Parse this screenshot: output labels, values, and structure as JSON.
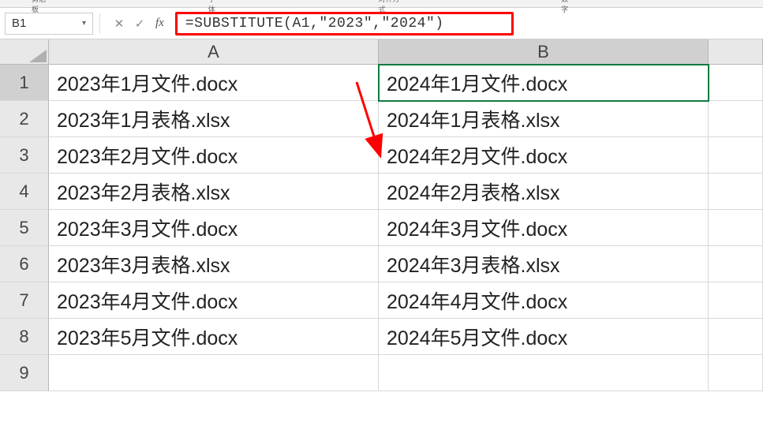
{
  "ribbon": {
    "group1": "剪贴板",
    "group2": "字体",
    "group3": "对齐方式",
    "group4": "数字"
  },
  "nameBox": {
    "value": "B1"
  },
  "formulaBar": {
    "fxCancel": "✕",
    "fxConfirm": "✓",
    "fxLabel": "fx",
    "formula": "=SUBSTITUTE(A1,\"2023\",\"2024\")"
  },
  "columns": {
    "a": "A",
    "b": "B"
  },
  "rows": [
    {
      "num": "1",
      "a": "2023年1月文件.docx",
      "b": "2024年1月文件.docx"
    },
    {
      "num": "2",
      "a": "2023年1月表格.xlsx",
      "b": "2024年1月表格.xlsx"
    },
    {
      "num": "3",
      "a": "2023年2月文件.docx",
      "b": "2024年2月文件.docx"
    },
    {
      "num": "4",
      "a": "2023年2月表格.xlsx",
      "b": "2024年2月表格.xlsx"
    },
    {
      "num": "5",
      "a": "2023年3月文件.docx",
      "b": "2024年3月文件.docx"
    },
    {
      "num": "6",
      "a": "2023年3月表格.xlsx",
      "b": "2024年3月表格.xlsx"
    },
    {
      "num": "7",
      "a": "2023年4月文件.docx",
      "b": "2024年4月文件.docx"
    },
    {
      "num": "8",
      "a": "2023年5月文件.docx",
      "b": "2024年5月文件.docx"
    },
    {
      "num": "9",
      "a": "",
      "b": ""
    }
  ]
}
